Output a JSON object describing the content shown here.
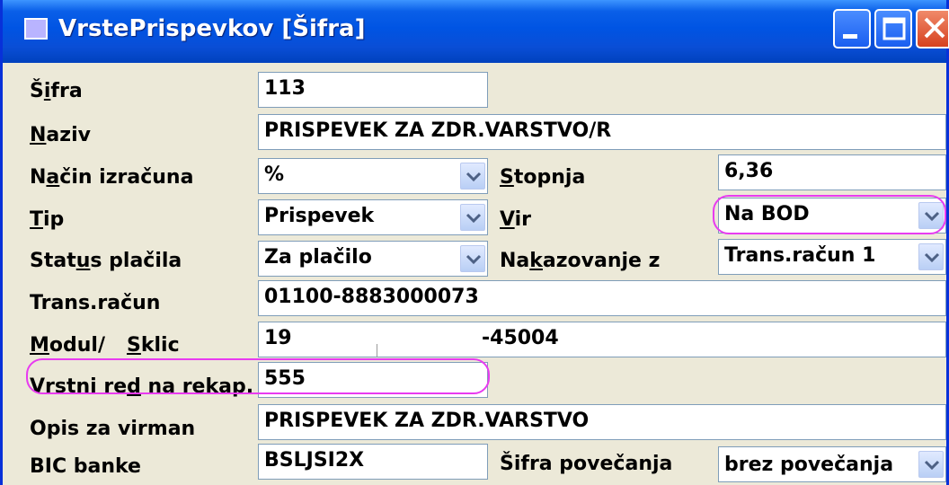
{
  "window": {
    "title": "VrstePrispevkov [Šifra]",
    "buttons": [
      "minimize-icon",
      "maximize-icon",
      "close-icon"
    ]
  },
  "form": {
    "sifra": {
      "label_pre": "Š",
      "label_ul": "i",
      "label_post": "fra",
      "value": "113"
    },
    "naziv": {
      "label_pre": "",
      "label_ul": "N",
      "label_post": "aziv",
      "value": "PRISPEVEK ZA ZDR.VARSTVO/R"
    },
    "nacin": {
      "label_pre": "N",
      "label_ul": "a",
      "label_post": "čin izračuna",
      "value": "%"
    },
    "stopnja": {
      "label_pre": "",
      "label_ul": "S",
      "label_post": "topnja",
      "value": "6,36"
    },
    "tip": {
      "label_pre": "",
      "label_ul": "T",
      "label_post": "ip",
      "value": "Prispevek"
    },
    "vir": {
      "label_pre": "",
      "label_ul": "V",
      "label_post": "ir",
      "value": "Na BOD"
    },
    "status": {
      "label_pre": "Stat",
      "label_ul": "u",
      "label_post": "s plačila",
      "value": "Za plačilo"
    },
    "nakazovanje": {
      "label_pre": "Na",
      "label_ul": "k",
      "label_post": "azovanje z",
      "value": "Trans.račun 1"
    },
    "trans_racun": {
      "label": "Trans.račun",
      "value": "01100-8883000073"
    },
    "modul_sklic": {
      "label_modul_ul": "M",
      "label_modul_post": "odul/",
      "label_sklic_ul": "S",
      "label_sklic_post": "klic",
      "value_modul": "19",
      "value_sklic": "-45004"
    },
    "vrstni_red": {
      "label_pre": "Vrstni re",
      "label_ul": "d",
      "label_post": " na rekap.",
      "value": "555"
    },
    "opis": {
      "label": "Opis za virman",
      "value": "PRISPEVEK ZA ZDR.VARSTVO"
    },
    "bic": {
      "label": "BIC banke",
      "value": "BSLJSI2X"
    },
    "sifra_pov": {
      "label": "Šifra povečanja",
      "value": "brez povečanja"
    }
  },
  "colors": {
    "titlebar": "#0054e3",
    "window_bg": "#ece9d8",
    "highlight": "#e83bf0",
    "field_border": "#7f9db9"
  }
}
